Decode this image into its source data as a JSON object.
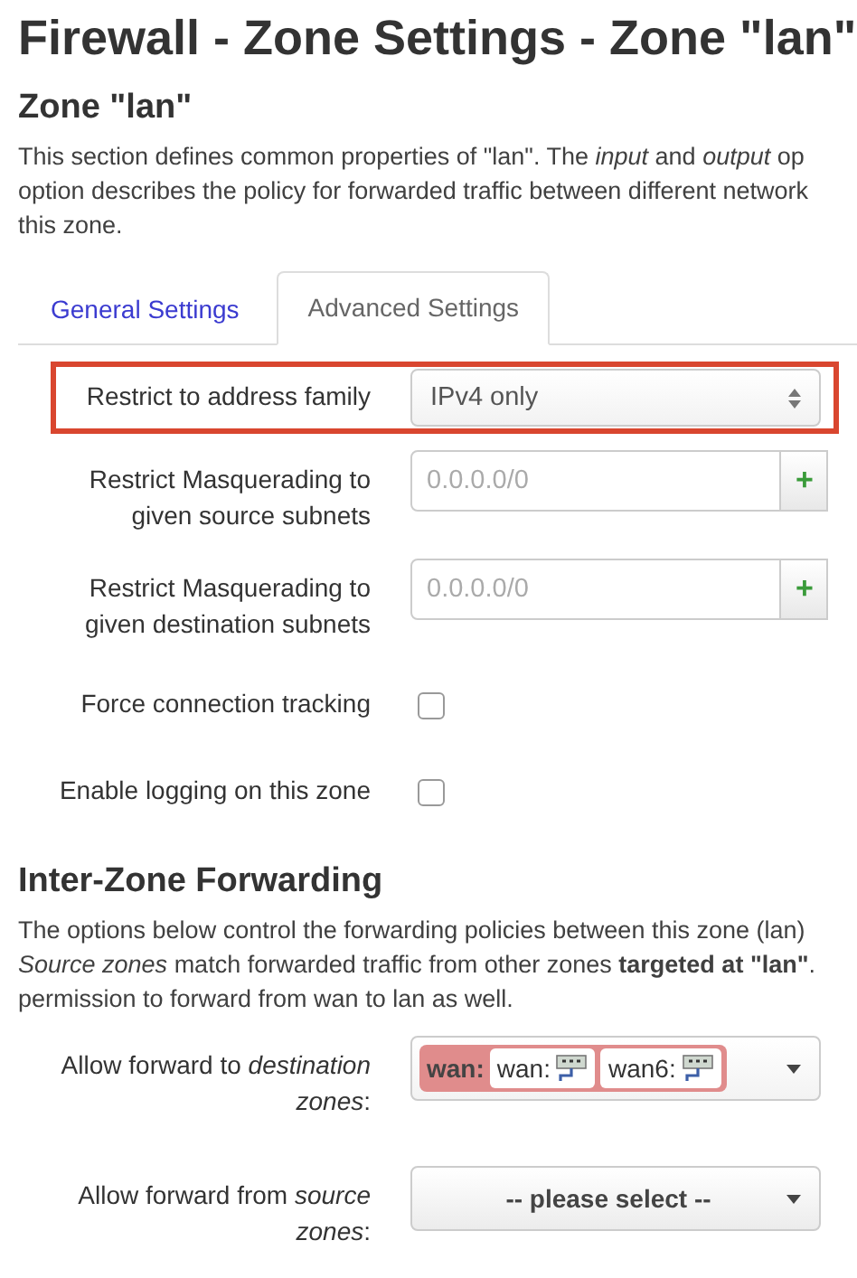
{
  "page_title": "Firewall - Zone Settings - Zone \"lan\"",
  "section": {
    "title": "Zone \"lan\"",
    "description_lines": [
      "This section defines common properties of \"lan\". The *input* and *output* op",
      "option describes the policy for forwarded traffic between different network",
      "this zone."
    ]
  },
  "tabs": [
    {
      "label": "General Settings",
      "selected": false
    },
    {
      "label": "Advanced Settings",
      "selected": true
    }
  ],
  "options": [
    {
      "kind": "select",
      "label": "Restrict to address family",
      "value": "IPv4 only",
      "highlighted": true
    },
    {
      "kind": "dynlist",
      "label": "Restrict Masquerading to given source subnets",
      "placeholder": "0.0.0.0/0",
      "button": "+",
      "highlighted": false
    },
    {
      "kind": "dynlist",
      "label": "Restrict Masquerading to given destination subnets",
      "placeholder": "0.0.0.0/0",
      "button": "+",
      "highlighted": false
    },
    {
      "kind": "checkbox",
      "label": "Force connection tracking",
      "checked": false,
      "highlighted": false
    },
    {
      "kind": "checkbox",
      "label": "Enable logging on this zone",
      "checked": false,
      "highlighted": false
    }
  ],
  "forwarding": {
    "title": "Inter-Zone Forwarding",
    "description_lines": [
      "The options below control the forwarding policies between this zone (lan)",
      "*Source zones* match forwarded traffic from other zones **targeted at \"lan\"**.",
      "permission to forward from wan to lan as well."
    ],
    "options": [
      {
        "kind": "multiselect",
        "label": "Allow forward to *destination zones*:",
        "zone": "wan:",
        "networks": [
          "wan:",
          "wan6:"
        ]
      },
      {
        "kind": "dropdown",
        "label": "Allow forward from *source zones*:",
        "value": "-- please select --"
      }
    ]
  }
}
